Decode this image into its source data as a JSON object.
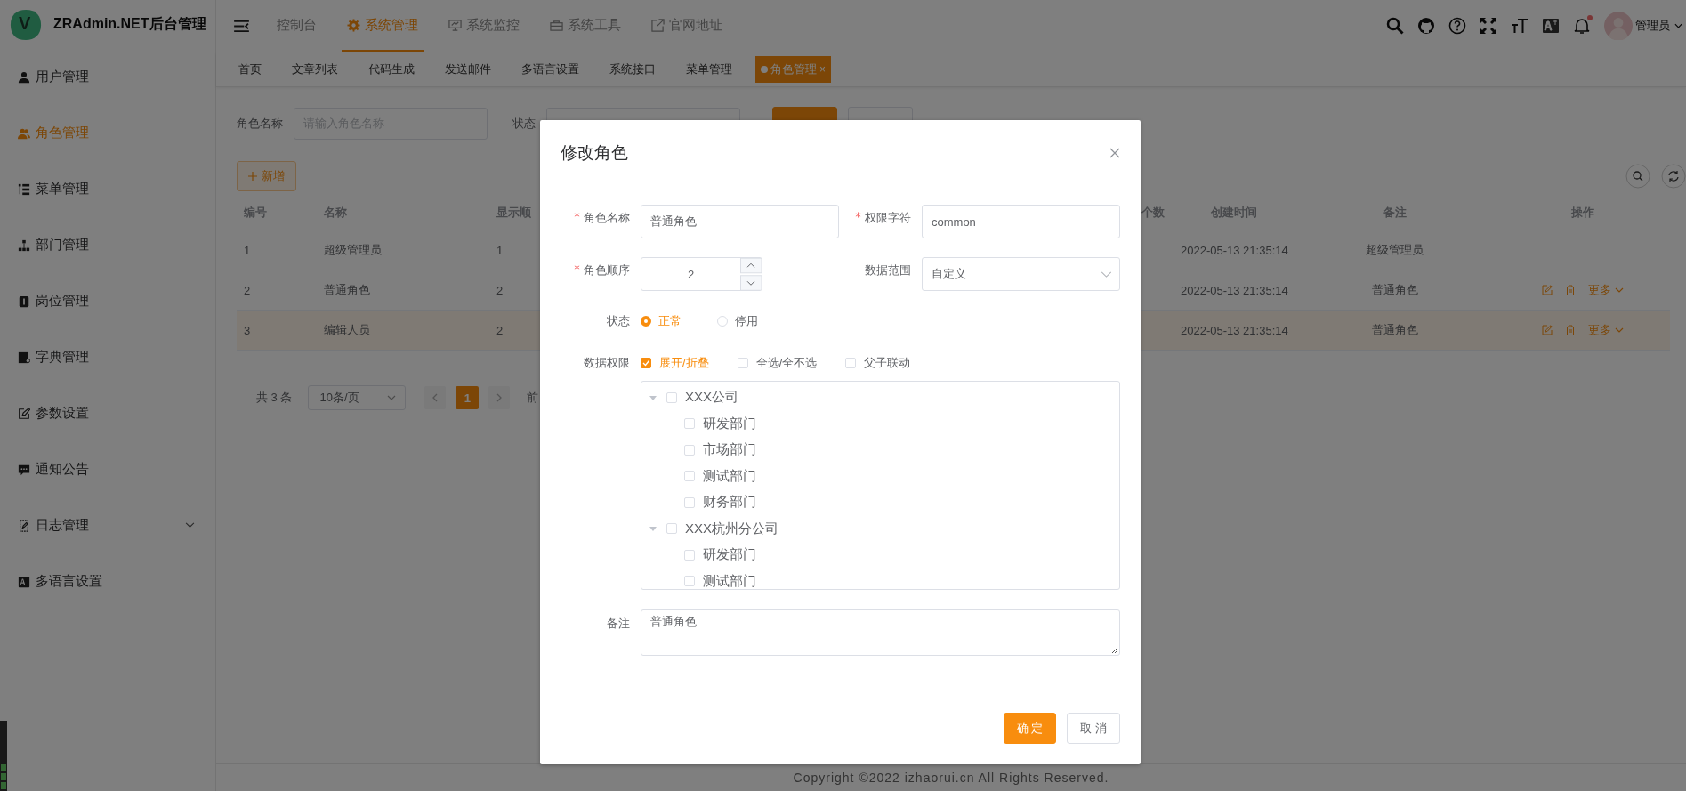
{
  "app": {
    "logo_letter": "V",
    "title": "ZRAdmin.NET后台管理"
  },
  "top_menu": [
    {
      "label": "控制台",
      "selected": false
    },
    {
      "label": "系统管理",
      "selected": true
    },
    {
      "label": "系统监控",
      "selected": false
    },
    {
      "label": "系统工具",
      "selected": false
    },
    {
      "label": "官网地址",
      "selected": false
    }
  ],
  "header": {
    "has_unread": true,
    "user_name": "管理员"
  },
  "sidebar": {
    "items": [
      {
        "label": "用户管理",
        "selected": false,
        "has_submenu": false
      },
      {
        "label": "角色管理",
        "selected": true,
        "has_submenu": false
      },
      {
        "label": "菜单管理",
        "selected": false,
        "has_submenu": false
      },
      {
        "label": "部门管理",
        "selected": false,
        "has_submenu": false
      },
      {
        "label": "岗位管理",
        "selected": false,
        "has_submenu": false
      },
      {
        "label": "字典管理",
        "selected": false,
        "has_submenu": false
      },
      {
        "label": "参数设置",
        "selected": false,
        "has_submenu": false
      },
      {
        "label": "通知公告",
        "selected": false,
        "has_submenu": false
      },
      {
        "label": "日志管理",
        "selected": false,
        "has_submenu": true
      },
      {
        "label": "多语言设置",
        "selected": false,
        "has_submenu": false
      }
    ]
  },
  "tags": [
    {
      "label": "首页",
      "selected": false
    },
    {
      "label": "文章列表",
      "selected": false
    },
    {
      "label": "代码生成",
      "selected": false
    },
    {
      "label": "发送邮件",
      "selected": false
    },
    {
      "label": "多语言设置",
      "selected": false
    },
    {
      "label": "系统接口",
      "selected": false
    },
    {
      "label": "菜单管理",
      "selected": false
    },
    {
      "label": "角色管理",
      "selected": true,
      "close": "×"
    }
  ],
  "search": {
    "name_label": "角色名称",
    "name_placeholder": "请输入角色名称",
    "status_label": "状态"
  },
  "toolbar": {
    "add_label": "新增"
  },
  "table": {
    "columns": [
      "编号",
      "名称",
      "显示顺",
      "个数",
      "创建时间",
      "备注",
      "操作"
    ],
    "rows": [
      {
        "id": "1",
        "name": "超级管理员",
        "order": "1",
        "created": "2022-05-13 21:35:14",
        "remark": "超级管理员",
        "highlighted": false
      },
      {
        "id": "2",
        "name": "普通角色",
        "order": "2",
        "created": "2022-05-13 21:35:14",
        "remark": "普通角色",
        "highlighted": false,
        "actions": [
          {
            "kind": "edit"
          },
          {
            "kind": "delete"
          },
          {
            "kind": "more",
            "label": "更多"
          }
        ]
      },
      {
        "id": "3",
        "name": "编辑人员",
        "order": "2",
        "created": "2022-05-13 21:35:14",
        "remark": "普通角色",
        "highlighted": true,
        "actions": [
          {
            "kind": "edit"
          },
          {
            "kind": "delete"
          },
          {
            "kind": "more",
            "label": "更多"
          }
        ]
      }
    ]
  },
  "pagination": {
    "total": "共 3 条",
    "page_size": "10条/页",
    "pages": [
      {
        "label": "1",
        "selected": true
      }
    ],
    "jump_label": "前"
  },
  "footer": {
    "copyright": "Copyright ©2022 izhaorui.cn All Rights Reserved."
  },
  "dialog": {
    "title": "修改角色",
    "role_name": {
      "label": "角色名称",
      "required": true,
      "value": "普通角色"
    },
    "role_key": {
      "label": "权限字符",
      "required": true,
      "value": "common"
    },
    "role_order": {
      "label": "角色顺序",
      "required": true,
      "value": "2"
    },
    "data_scope": {
      "label": "数据范围",
      "required": false,
      "value": "自定义"
    },
    "status": {
      "label": "状态",
      "options": [
        {
          "label": "正常",
          "selected": true
        },
        {
          "label": "停用",
          "selected": false
        }
      ]
    },
    "data_permission": {
      "label": "数据权限",
      "options": [
        {
          "label": "展开/折叠",
          "checked": true
        },
        {
          "label": "全选/全不选",
          "checked": false
        },
        {
          "label": "父子联动",
          "checked": false
        }
      ],
      "tree": [
        {
          "label": "XXX公司",
          "checked": false,
          "expanded": true,
          "children": [
            {
              "label": "研发部门",
              "checked": false
            },
            {
              "label": "市场部门",
              "checked": false
            },
            {
              "label": "测试部门",
              "checked": false
            },
            {
              "label": "财务部门",
              "checked": false
            }
          ]
        },
        {
          "label": "XXX杭州分公司",
          "checked": false,
          "expanded": true,
          "children": [
            {
              "label": "研发部门",
              "checked": false
            },
            {
              "label": "测试部门",
              "checked": false
            }
          ]
        }
      ]
    },
    "remark": {
      "label": "备注",
      "value": "普通角色"
    },
    "buttons": [
      {
        "label": "确 定",
        "kind": "primary"
      },
      {
        "label": "取 消",
        "kind": "default"
      }
    ]
  }
}
